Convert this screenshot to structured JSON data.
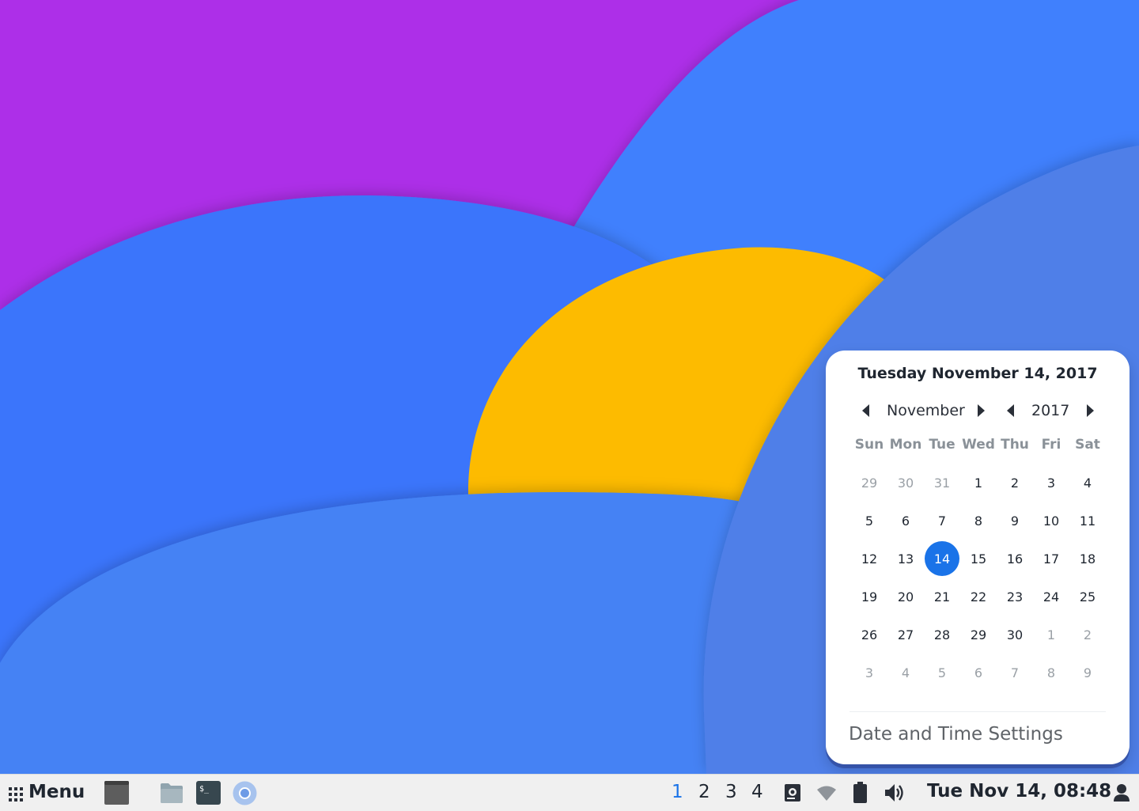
{
  "calendar": {
    "title": "Tuesday November 14, 2017",
    "month_label": "November",
    "year_label": "2017",
    "weekdays": [
      "Sun",
      "Mon",
      "Tue",
      "Wed",
      "Thu",
      "Fri",
      "Sat"
    ],
    "weeks": [
      [
        "29",
        "30",
        "31",
        "1",
        "2",
        "3",
        "4"
      ],
      [
        "5",
        "6",
        "7",
        "8",
        "9",
        "10",
        "11"
      ],
      [
        "12",
        "13",
        "14",
        "15",
        "16",
        "17",
        "18"
      ],
      [
        "19",
        "20",
        "21",
        "22",
        "23",
        "24",
        "25"
      ],
      [
        "26",
        "27",
        "28",
        "29",
        "30",
        "1",
        "2"
      ],
      [
        "3",
        "4",
        "5",
        "6",
        "7",
        "8",
        "9"
      ]
    ],
    "selected_day": "14",
    "settings_label": "Date and Time Settings",
    "accent": "#1a73e8"
  },
  "taskbar": {
    "menu_label": "Menu",
    "launchers": [
      "window-icon",
      "files-icon",
      "terminal-icon",
      "browser-icon"
    ],
    "workspaces": [
      "1",
      "2",
      "3",
      "4"
    ],
    "active_workspace": "1",
    "tray": [
      "screenshot-icon",
      "wifi-icon",
      "battery-icon",
      "volume-icon"
    ],
    "clock": "Tue Nov 14, 08:48",
    "user_icon": "user-icon"
  }
}
